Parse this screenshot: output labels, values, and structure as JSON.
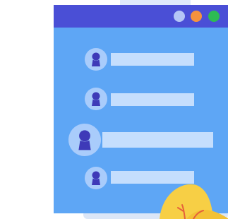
{
  "window": {
    "controls": [
      {
        "name": "window-dot-light",
        "color": "#b4c6f6"
      },
      {
        "name": "window-dot-orange",
        "color": "#f6923e"
      },
      {
        "name": "window-dot-green",
        "color": "#2dbb54"
      }
    ]
  },
  "contacts": {
    "rows": 4,
    "highlighted_row": 3,
    "avatar_icon": "person-silhouette-icon"
  },
  "colors": {
    "window_body": "#5ea6f5",
    "titlebar": "#4a4fd6",
    "avatar_bg": "#a9ccfb",
    "avatar_figure": "#3e3ab8",
    "bar": "#c5defd",
    "plant_leaf": "#f7cf45",
    "plant_stem": "#e6613a"
  },
  "decoration": {
    "plant_icon": "yellow-plant-icon"
  }
}
